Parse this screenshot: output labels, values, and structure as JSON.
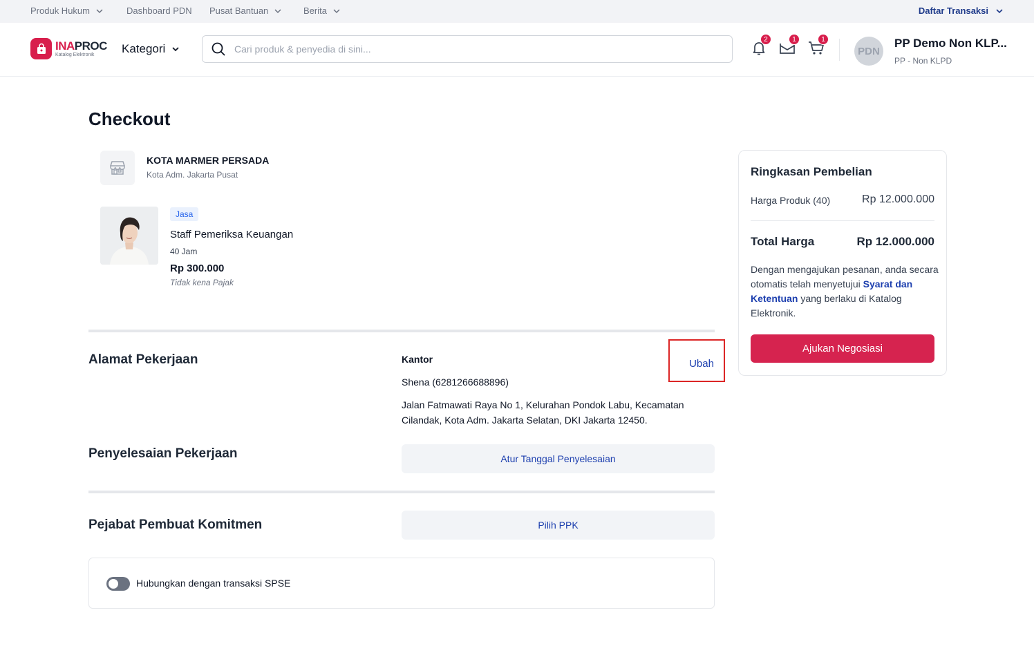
{
  "topbar": {
    "links": [
      "Produk Hukum",
      "Dashboard PDN",
      "Pusat Bantuan",
      "Berita"
    ],
    "right": "Daftar Transaksi"
  },
  "header": {
    "logo_main_a": "INA",
    "logo_main_b": "PROC",
    "logo_sub": "Katalog Elektronik",
    "kategori": "Kategori",
    "search_placeholder": "Cari produk & penyedia di sini...",
    "notif_count": "2",
    "mail_count": "1",
    "cart_count": "1",
    "avatar_initials": "PDN",
    "user_name": "PP Demo Non KLP...",
    "user_role": "PP - Non KLPD"
  },
  "page": {
    "title": "Checkout"
  },
  "store": {
    "name": "KOTA MARMER PERSADA",
    "location": "Kota Adm. Jakarta Pusat"
  },
  "product": {
    "tag": "Jasa",
    "name": "Staff Pemeriksa Keuangan",
    "qty": "40 Jam",
    "price": "Rp 300.000",
    "tax": "Tidak kena Pajak"
  },
  "address": {
    "section_title": "Alamat Pekerjaan",
    "label": "Kantor",
    "contact": "Shena (6281266688896)",
    "text": "Jalan Fatmawati Raya No 1, Kelurahan Pondok Labu, Kecamatan Cilandak, Kota Adm. Jakarta Selatan, DKI Jakarta 12450.",
    "edit": "Ubah"
  },
  "completion": {
    "section_title": "Penyelesaian Pekerjaan",
    "button": "Atur Tanggal Penyelesaian"
  },
  "ppk": {
    "section_title": "Pejabat Pembuat Komitmen",
    "button": "Pilih PPK"
  },
  "spse": {
    "label": "Hubungkan dengan transaksi SPSE",
    "enabled": false
  },
  "summary": {
    "title": "Ringkasan Pembelian",
    "product_label": "Harga Produk (40)",
    "product_value": "Rp 12.000.000",
    "total_label": "Total Harga",
    "total_value": "Rp 12.000.000",
    "terms_pre": "Dengan mengajukan pesanan, anda secara otomatis telah menyetujui ",
    "terms_link": "Syarat dan Ketentuan",
    "terms_post": " yang berlaku di Katalog Elektronik.",
    "cta": "Ajukan Negosiasi"
  },
  "colors": {
    "brand": "#d81e4c",
    "link": "#1e40af",
    "highlight": "#dc2626"
  }
}
